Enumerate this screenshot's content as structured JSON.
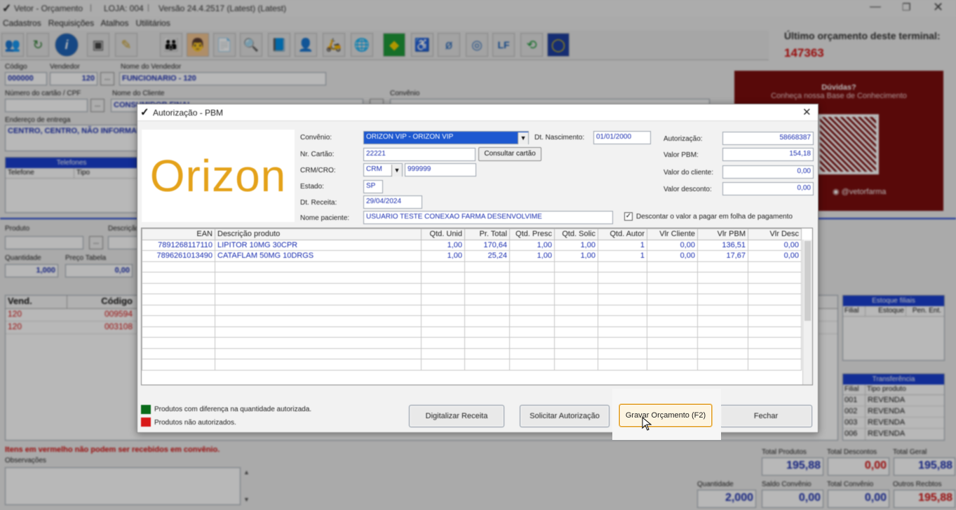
{
  "window": {
    "title": "Vetor - Orçamento",
    "store": "LOJA: 004",
    "version": "Versão 24.4.2517 (Latest) (Latest)"
  },
  "menu": [
    "Cadastros",
    "Requisições",
    "Atalhos",
    "Utilitários"
  ],
  "last_quote": {
    "label": "Último orçamento deste terminal:",
    "value": "147363"
  },
  "form": {
    "codigo_label": "Código",
    "codigo": "000000",
    "vendedor_label": "Vendedor",
    "vendedor": "120",
    "nome_vendedor_label": "Nome do Vendedor",
    "nome_vendedor": "FUNCIONARIO - 120",
    "cartao_label": "Número do cartão / CPF",
    "nome_cliente_label": "Nome do Cliente",
    "nome_cliente": "CONSUMIDOR FINAL",
    "convenio_label": "Convênio",
    "endereco_label": "Endereço de entrega",
    "endereco": "CENTRO, CENTRO, NÃO INFORMADO",
    "telefones_title": "Telefones",
    "telefone_col": "Telefone",
    "tipo_col": "Tipo",
    "produto_label": "Produto",
    "descricao_label": "Descrição",
    "quantidade_label": "Quantidade",
    "quantidade": "1,000",
    "preco_label": "Preço Tabela",
    "preco": "0,00",
    "ellipsis": "..."
  },
  "items": {
    "cols": [
      "Vend.",
      "Código"
    ],
    "rows": [
      [
        "120",
        "009594"
      ],
      [
        "120",
        "003108"
      ]
    ]
  },
  "warning": "Itens em vermelho não podem ser recebidos em convênio.",
  "observacoes_label": "Observações",
  "help": {
    "title": "Dúvidas?",
    "subtitle": "Conheça nossa Base de Conhecimento",
    "handle": "@vetorfarma"
  },
  "estoque": {
    "title": "Estoque filiais",
    "cols": [
      "Filial",
      "Estoque",
      "Pen. Ent."
    ]
  },
  "transferencia": {
    "title": "Transferência",
    "cols": [
      "Filial",
      "Tipo produto"
    ],
    "rows": [
      [
        "001",
        "REVENDA"
      ],
      [
        "002",
        "REVENDA"
      ],
      [
        "003",
        "REVENDA"
      ],
      [
        "006",
        "REVENDA"
      ]
    ]
  },
  "totals": {
    "total_produtos_label": "Total Produtos",
    "total_produtos": "195,88",
    "total_descontos_label": "Total Descontos",
    "total_descontos": "0,00",
    "total_geral_label": "Total Geral",
    "total_geral": "195,88",
    "quantidade_label": "Quantidade",
    "quantidade": "2,000",
    "saldo_label": "Saldo Convênio",
    "saldo": "0,00",
    "total_convenio_label": "Total Convênio",
    "total_convenio": "0,00",
    "outros_label": "Outros Recbtos",
    "outros": "195,88"
  },
  "dialog": {
    "title": "Autorização - PBM",
    "logo": "Orizon",
    "convenio_label": "Convênio:",
    "convenio": "ORIZON VIP - ORIZON VIP",
    "nascimento_label": "Dt. Nascimento:",
    "nascimento": "01/01/2000",
    "cartao_label": "Nr. Cartão:",
    "cartao": "22221",
    "consultar": "Consultar cartão",
    "crm_label": "CRM/CRO:",
    "crm_tipo": "CRM",
    "crm": "999999",
    "estado_label": "Estado:",
    "estado": "SP",
    "receita_label": "Dt. Receita:",
    "receita": "29/04/2024",
    "paciente_label": "Nome paciente:",
    "paciente": "USUARIO TESTE CONEXAO FARMA DESENVOLVIME",
    "autorizacao_label": "Autorização:",
    "autorizacao": "58668387",
    "valor_pbm_label": "Valor PBM:",
    "valor_pbm": "154,18",
    "valor_cliente_label": "Valor do cliente:",
    "valor_cliente": "0,00",
    "valor_desconto_label": "Valor desconto:",
    "valor_desconto": "0,00",
    "descontar": "Descontar o valor a pagar em folha de pagamento",
    "cols": [
      "EAN",
      "Descrição produto",
      "Qtd. Unid",
      "Pr. Total",
      "Qtd. Presc",
      "Qtd. Solic",
      "Qtd. Autor",
      "Vlr Cliente",
      "Vlr PBM",
      "Vlr Desc"
    ],
    "rows": [
      [
        "7891268117110",
        "LIPITOR 10MG 30CPR",
        "1,00",
        "170,64",
        "1,00",
        "1,00",
        "1",
        "0,00",
        "136,51",
        "0,00"
      ],
      [
        "7896261013490",
        "CATAFLAM 50MG 10DRGS",
        "1,00",
        "25,24",
        "1,00",
        "1,00",
        "1",
        "0,00",
        "17,67",
        "0,00"
      ]
    ],
    "legend_green": "Produtos com diferença na quantidade autorizada.",
    "legend_red": "Produtos não autorizados.",
    "btn_digitalizar": "Digitalizar Receita",
    "btn_solicitar": "Solicitar Autorização",
    "btn_gravar": "Gravar Orçamento (F2)",
    "btn_fechar": "Fechar",
    "colors": {
      "green": "#0a6b1a",
      "red": "#d81818",
      "accent_blue": "#1b2fb0",
      "help_bg": "#7a0d0d"
    }
  }
}
